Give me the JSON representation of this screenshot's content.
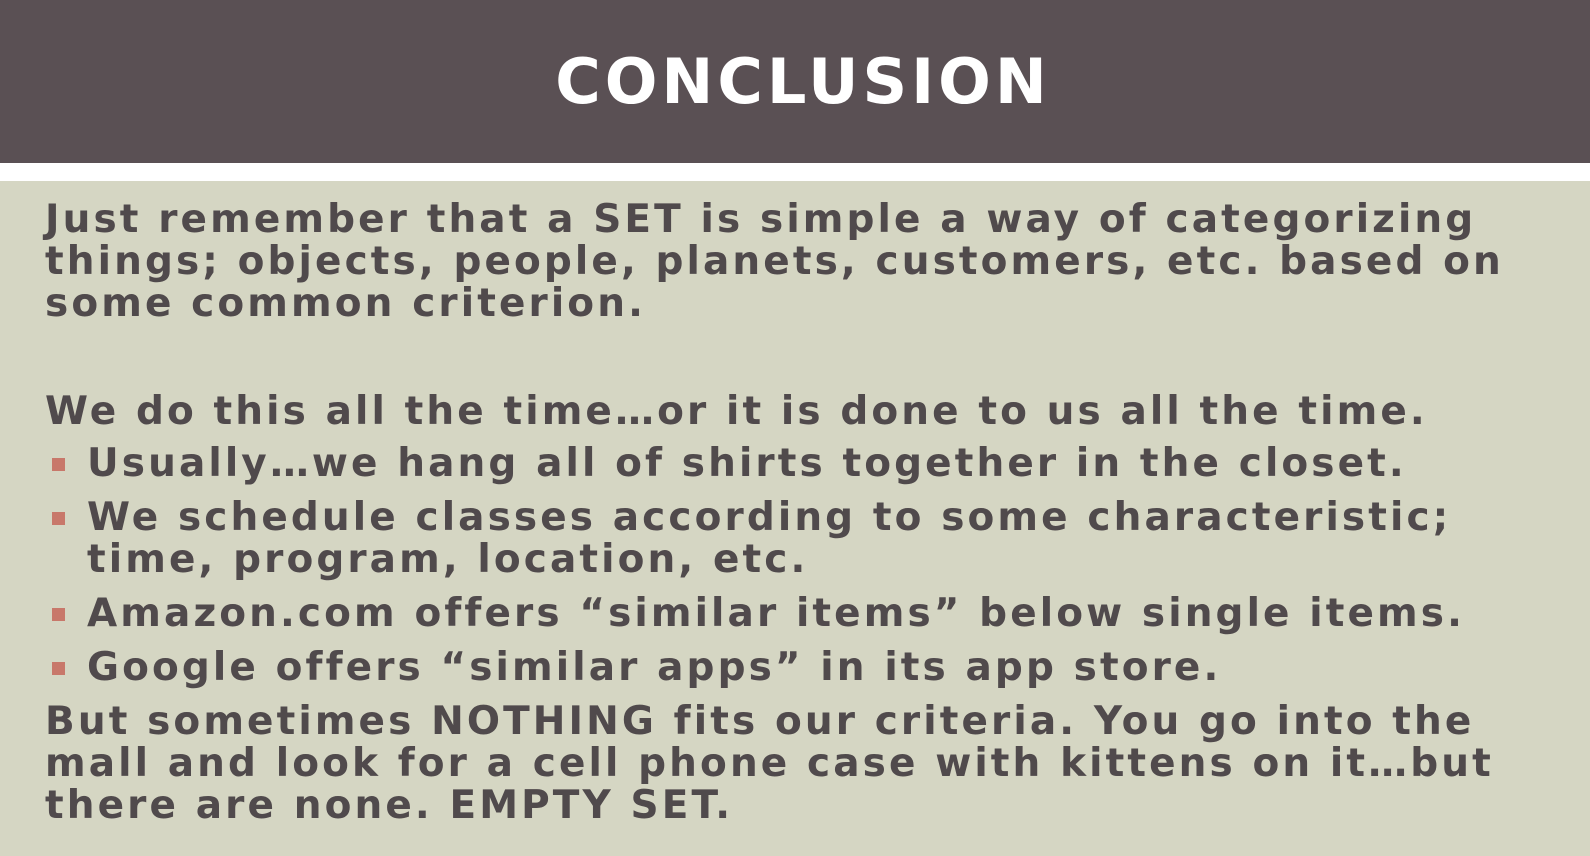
{
  "slide": {
    "title": "CONCLUSION",
    "intro": "Just remember that a SET is simple a way of categorizing things; objects, people, planets, customers, etc. based on some common criterion.",
    "lead": "We do this all the time…or it is done to us all the time.",
    "bullets": [
      "Usually…we hang all of shirts together in the closet.",
      "We schedule classes according to some characteristic; time, program, location, etc.",
      "Amazon.com offers “similar items” below single items.",
      "Google offers “similar apps” in its app store."
    ],
    "closing": "But sometimes NOTHING fits our criteria. You go into the mall and look for a cell phone case with kittens on it…but there are none. EMPTY SET."
  },
  "colors": {
    "title_bar": "#5a5054",
    "background": "#d5d6c3",
    "text": "#504a4c",
    "bullet_marker": "#c8786a"
  }
}
